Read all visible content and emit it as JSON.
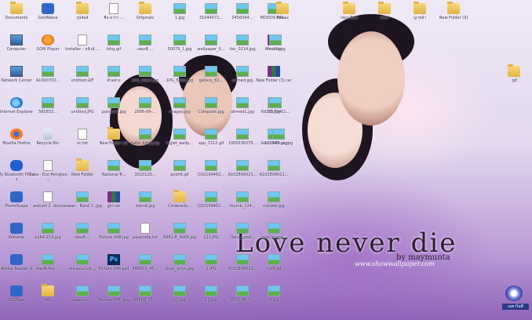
{
  "wallpaper": {
    "title": "Love never die",
    "byline": "by maymunta",
    "site": "www.showwallpaper.com"
  },
  "tray": {
    "label": "เมตาไอตี"
  },
  "icons": [
    {
      "label": "Documents",
      "type": "folder"
    },
    {
      "label": "Computer",
      "type": "pc"
    },
    {
      "label": "Network Center",
      "type": "pc"
    },
    {
      "label": "Internet Explorer",
      "type": "ie"
    },
    {
      "label": "Mozilla Firefox",
      "type": "fire"
    },
    {
      "label": "My Bluetooth Places",
      "type": "bt"
    },
    {
      "label": "PhotoScape",
      "type": "app"
    },
    {
      "label": "Winamp",
      "type": "app"
    },
    {
      "label": "Adobe Reader 9",
      "type": "app"
    },
    {
      "label": "ACDSee",
      "type": "app"
    },
    {
      "label": "GoldWave",
      "type": "app"
    },
    {
      "label": "GOM Player",
      "type": "wmp"
    },
    {
      "label": "A1000702...",
      "type": "img"
    },
    {
      "label": "565833...",
      "type": "img"
    },
    {
      "label": "Recycle Bin",
      "type": "rec"
    },
    {
      "label": "Tiara - Eso Peingleo ...",
      "type": "doc"
    },
    {
      "label": "asticell 2 .docx",
      "type": "doc"
    },
    {
      "label": "e164-214.jpg",
      "type": "img"
    },
    {
      "label": "เพลงพี่เจียม ...",
      "type": "img"
    },
    {
      "label": "หนัง",
      "type": "folder"
    },
    {
      "label": "รูปส์อล์",
      "type": "folder"
    },
    {
      "label": "Installer - หลิวส์ ...",
      "type": "doc"
    },
    {
      "label": "untitled.GIF",
      "type": "img"
    },
    {
      "label": "untitled.JPG",
      "type": "img"
    },
    {
      "label": "vc.txt",
      "type": "doc"
    },
    {
      "label": "New Folder",
      "type": "folder"
    },
    {
      "label": "aowan - Band 1 .jpg",
      "type": "img"
    },
    {
      "label": "เพลงพี่ ...",
      "type": "img"
    },
    {
      "label": "เพลงออนไลน์ ...",
      "type": "img"
    },
    {
      "label": "เพลงออน ...",
      "type": "img"
    },
    {
      "label": "ชื่อ ดารา ...",
      "type": "doc"
    },
    {
      "label": "fshg.gif",
      "type": "img"
    },
    {
      "label": "ตัวอย่าง",
      "type": "img"
    },
    {
      "label": "postpaid.jpg",
      "type": "img"
    },
    {
      "label": "New Folder (2)",
      "type": "folder"
    },
    {
      "label": "National-Tr...",
      "type": "img"
    },
    {
      "label": "girl.rar",
      "type": "rar"
    },
    {
      "label": "Picture 048.jpg",
      "type": "img"
    },
    {
      "label": "Picture 048.psd",
      "type": "ps"
    },
    {
      "label": "Picture 048 .jpg",
      "type": "img"
    },
    {
      "label": "Originals",
      "type": "folder"
    },
    {
      "label": "เพลงพี่ ...",
      "type": "img"
    },
    {
      "label": "1PG_4423.jpg",
      "type": "img"
    },
    {
      "label": "2006-09-...",
      "type": "img"
    },
    {
      "label": "hello_kitty.png",
      "type": "img"
    },
    {
      "label": "3010120...",
      "type": "img"
    },
    {
      "label": "mendi.jpg",
      "type": "img"
    },
    {
      "label": "passcode.txt",
      "type": "doc"
    },
    {
      "label": "666601_45...",
      "type": "img"
    },
    {
      "label": "66609_15...",
      "type": "img"
    },
    {
      "label": "1.jpg",
      "type": "img"
    },
    {
      "label": "50079_1.jpg",
      "type": "img"
    },
    {
      "label": "1PG_5084.jpg",
      "type": "img"
    },
    {
      "label": "images.jpg",
      "type": "img"
    },
    {
      "label": "Piglet_wallp...",
      "type": "img"
    },
    {
      "label": "pooh6.gif",
      "type": "img"
    },
    {
      "label": "Cinderella...",
      "type": "folder"
    },
    {
      "label": "6881-8_4kK8.jpg",
      "type": "img"
    },
    {
      "label": "Gass_gmm.jpg",
      "type": "img"
    },
    {
      "label": "11.jpg",
      "type": "img"
    },
    {
      "label": "31044072...",
      "type": "img"
    },
    {
      "label": "wallpaper_0...",
      "type": "img"
    },
    {
      "label": "gallery_82...",
      "type": "img"
    },
    {
      "label": "Cutepooh.jpg",
      "type": "img"
    },
    {
      "label": "app_7212.gif",
      "type": "img"
    },
    {
      "label": "Q10199462...",
      "type": "img"
    },
    {
      "label": "Q10199462...",
      "type": "img"
    },
    {
      "label": "123.JPG",
      "type": "img"
    },
    {
      "label": "1.JPG",
      "type": "img"
    },
    {
      "label": "11.jpg",
      "type": "img"
    },
    {
      "label": "0456094...",
      "type": "img"
    },
    {
      "label": "dsc_0214.jpg",
      "type": "img"
    },
    {
      "label": "ahmed.jpg",
      "type": "img"
    },
    {
      "label": "ahmed1.jpg",
      "type": "img"
    },
    {
      "label": "1005536275...",
      "type": "img"
    },
    {
      "label": "A102899021...",
      "type": "img"
    },
    {
      "label": "thumb_124...",
      "type": "img"
    },
    {
      "label": "Oam_good...",
      "type": "img"
    },
    {
      "label": "A102899021...",
      "type": "img"
    },
    {
      "label": "2010_89_0...",
      "type": "img"
    },
    {
      "label": "MOOOS-Pan...",
      "type": "img"
    },
    {
      "label": "mini.rar",
      "type": "rar"
    },
    {
      "label": "New Folder (3).rar",
      "type": "rar"
    },
    {
      "label": "55.jpg",
      "type": "img"
    },
    {
      "label": "2ebz1995.jpg",
      "type": "img"
    },
    {
      "label": "A102899021...",
      "type": "img"
    },
    {
      "label": "cutsleb.jpg",
      "type": "img"
    },
    {
      "label": "crop(image...",
      "type": "img"
    },
    {
      "label": "ngth.gif",
      "type": "img"
    },
    {
      "label": "3.jpg",
      "type": "img"
    },
    {
      "label": "ซีดีพลง",
      "type": "folder"
    },
    {
      "label": "MacAll.jpg",
      "type": "img"
    },
    {
      "label": "6929579461...",
      "type": "img"
    },
    {
      "label": "107849-pc.jpg",
      "type": "img"
    },
    {
      "label": "เพลงเพื่อน",
      "type": "folder"
    },
    {
      "label": "mini",
      "type": "folder"
    },
    {
      "label": "ญาหล้า",
      "type": "folder"
    },
    {
      "label": "New Folder (3)",
      "type": "folder"
    },
    {
      "label": ".gif",
      "type": "folder"
    }
  ]
}
